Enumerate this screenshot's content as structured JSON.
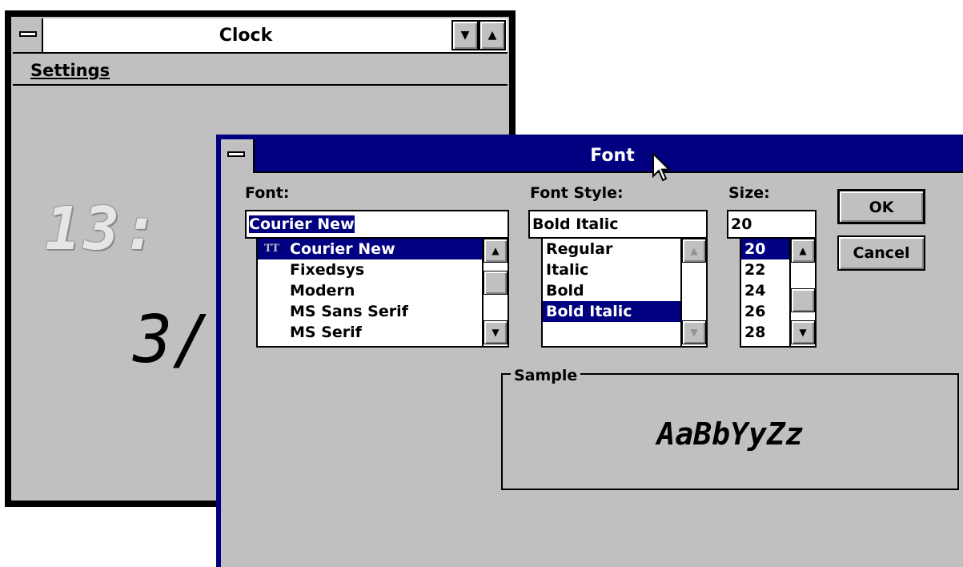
{
  "clock_window": {
    "title": "Clock",
    "menu": {
      "settings_label": "Settings"
    },
    "time_visible": "13:",
    "date_visible": "3/",
    "minimize_glyph": "▼",
    "maximize_glyph": "▲"
  },
  "font_dialog": {
    "title": "Font",
    "font": {
      "label": "Font:",
      "value": "Courier New",
      "items": [
        "Courier New",
        "Fixedsys",
        "Modern",
        "MS Sans Serif",
        "MS Serif"
      ],
      "truetype_glyph": "TT"
    },
    "style": {
      "label": "Font Style:",
      "value": "Bold Italic",
      "items": [
        "Regular",
        "Italic",
        "Bold",
        "Bold Italic"
      ]
    },
    "size": {
      "label": "Size:",
      "value": "20",
      "items": [
        "20",
        "22",
        "24",
        "26",
        "28"
      ]
    },
    "buttons": {
      "ok": "OK",
      "cancel": "Cancel"
    },
    "sample": {
      "label": "Sample",
      "text": "AaBbYyZz"
    }
  },
  "colors": {
    "title_active": "#000080",
    "face": "#c0c0c0",
    "highlight": "#000080"
  },
  "icons": {
    "scroll_up": "up-arrow-icon",
    "scroll_down": "down-arrow-icon",
    "system_menu": "system-menu-icon",
    "cursor": "mouse-pointer-icon"
  }
}
